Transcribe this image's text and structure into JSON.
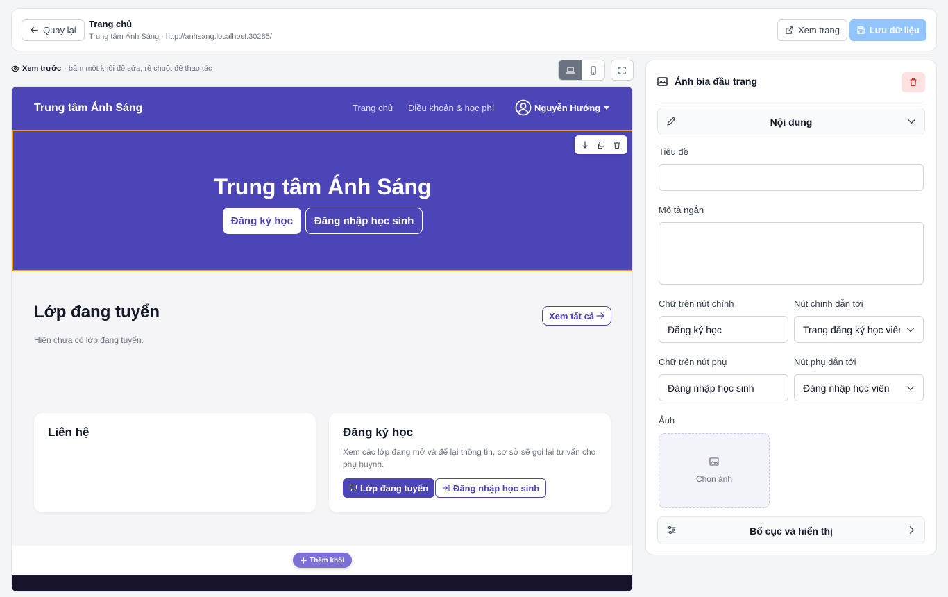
{
  "topbar": {
    "back_label": "Quay lại",
    "page_title": "Trang chủ",
    "page_subtitle": "Trung tâm Ánh Sáng · http://anhsang.localhost:30285/",
    "view_label": "Xem trang",
    "save_label": "Lưu dữ liệu"
  },
  "preview": {
    "label": "Xem trước",
    "hint": "· bấm một khối để sửa, rê chuột để thao tác"
  },
  "site": {
    "brand": "Trung tâm Ánh Sáng",
    "nav": [
      "Trang chủ",
      "Điều khoản & học phí"
    ],
    "user": "Nguyễn Hướng",
    "hero": {
      "title": "Trung tâm Ánh Sáng",
      "primary": "Đăng ký học",
      "secondary": "Đăng nhập học sinh"
    },
    "section": {
      "title": "Lớp đang tuyển",
      "empty": "Hiện chưa có lớp đang tuyển.",
      "view_all": "Xem tất cả"
    },
    "contact": {
      "title": "Liên hệ"
    },
    "register": {
      "title": "Đăng ký học",
      "desc": "Xem các lớp đang mở và để lại thông tin, cơ sở sẽ gọi lại tư vấn cho phụ huynh.",
      "btn1": "Lớp đang tuyển",
      "btn2": "Đăng nhập học sinh"
    },
    "add_block": "Thêm khối"
  },
  "panel": {
    "title": "Ảnh bìa đầu trang",
    "content_section": "Nội dung",
    "fields": {
      "title_label": "Tiêu đề",
      "title_value": "",
      "desc_label": "Mô tả ngắn",
      "desc_value": "",
      "primary_text_label": "Chữ trên nút chính",
      "primary_text_value": "Đăng ký học",
      "primary_link_label": "Nút chính dẫn tới",
      "primary_link_value": "Trang đăng ký học viên",
      "secondary_text_label": "Chữ trên nút phụ",
      "secondary_text_value": "Đăng nhập học sinh",
      "secondary_link_label": "Nút phụ dẫn tới",
      "secondary_link_value": "Đăng nhập học viên",
      "image_label": "Ảnh",
      "image_pick": "Chọn ảnh"
    },
    "layout_section": "Bố cục và hiển thị"
  },
  "colors": {
    "brand": "#4c45b8",
    "hero_border": "#f59e0b",
    "save_button": "#93c5fd",
    "delete_bg": "#fee2e2"
  }
}
